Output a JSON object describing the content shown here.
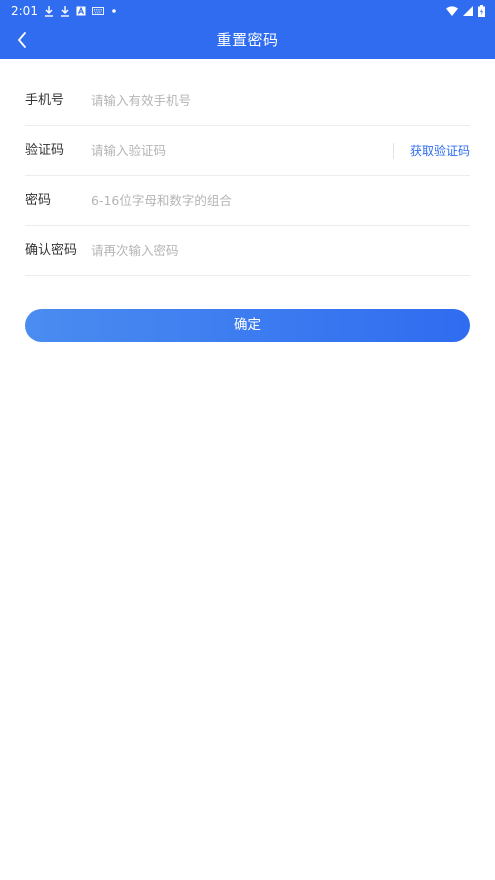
{
  "status_bar": {
    "time": "2:01",
    "left_icons": [
      "download-icon",
      "download-icon",
      "a-box-icon",
      "keyboard-icon",
      "dot-icon"
    ],
    "right_icons": [
      "wifi-icon",
      "signal-icon",
      "battery-icon"
    ]
  },
  "header": {
    "title": "重置密码",
    "back_icon": "chevron-left-icon",
    "color": "#2f6cf0"
  },
  "form": {
    "phone": {
      "label": "手机号",
      "placeholder": "请输入有效手机号",
      "value": ""
    },
    "code": {
      "label": "验证码",
      "placeholder": "请输入验证码",
      "value": "",
      "button_label": "获取验证码"
    },
    "password": {
      "label": "密码",
      "placeholder": "6-16位字母和数字的组合",
      "value": ""
    },
    "confirm_password": {
      "label": "确认密码",
      "placeholder": "请再次输入密码",
      "value": ""
    }
  },
  "submit": {
    "label": "确定",
    "gradient": [
      "#4a8cf0",
      "#2f6cf0"
    ]
  }
}
